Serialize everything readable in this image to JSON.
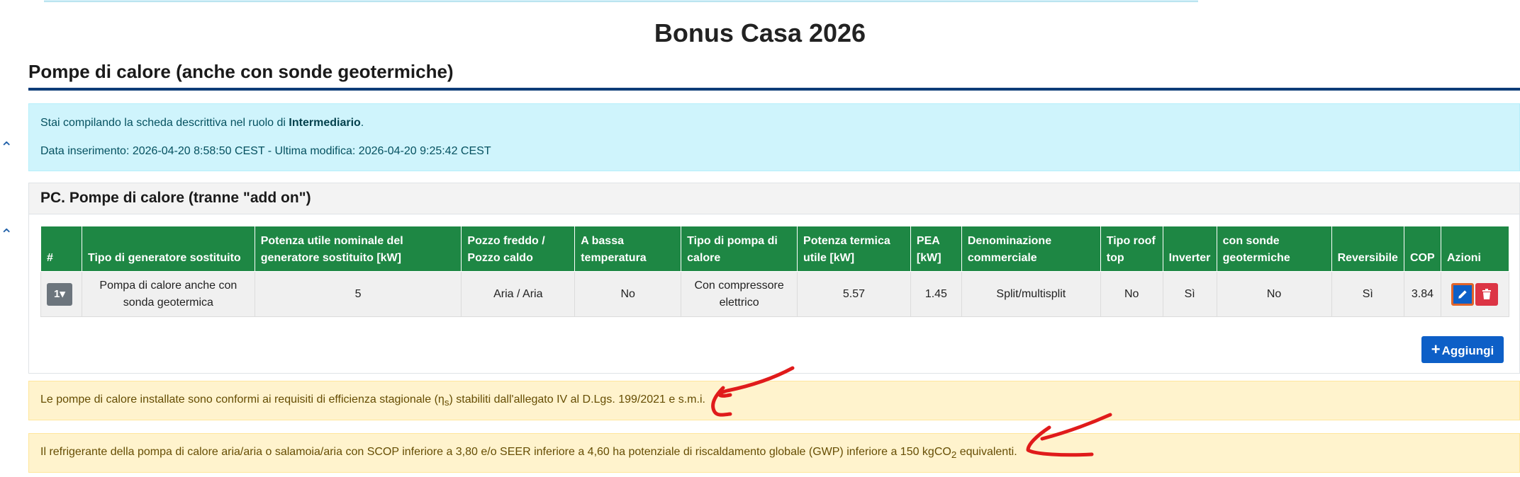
{
  "page": {
    "title": "Bonus Casa 2026"
  },
  "section": {
    "title": "Pompe di calore (anche con sonde geotermiche)"
  },
  "info": {
    "role_prefix": "Stai compilando la scheda descrittiva nel ruolo di ",
    "role": "Intermediario",
    "role_suffix": ".",
    "dates": "Data inserimento: 2026-04-20 8:58:50 CEST - Ultima modifica: 2026-04-20 9:25:42 CEST"
  },
  "card": {
    "title": "PC. Pompe di calore (tranne \"add on\")",
    "add_label": "Aggiungi",
    "table": {
      "headers": [
        "#",
        "Tipo di generatore sostituito",
        "Potenza utile nominale del generatore sostituito [kW]",
        "Pozzo freddo / Pozzo caldo",
        "A bassa temperatura",
        "Tipo di pompa di calore",
        "Potenza termica utile [kW]",
        "PEA [kW]",
        "Denominazione commerciale",
        "Tipo roof top",
        "Inverter",
        "con sonde geotermiche",
        "Reversibile",
        "COP",
        "Azioni"
      ],
      "rows": [
        {
          "index": "1▾",
          "cells": [
            "Pompa di calore anche con sonda geotermica",
            "5",
            "Aria / Aria",
            "No",
            "Con compressore elettrico",
            "5.57",
            "1.45",
            "Split/multisplit",
            "No",
            "Sì",
            "No",
            "Sì",
            "3.84"
          ]
        }
      ]
    }
  },
  "notes": {
    "efficiency_pre": "Le pompe di calore installate sono conformi ai requisiti di efficienza stagionale (",
    "efficiency_eta": "η",
    "efficiency_sub": "s",
    "efficiency_post": ") stabiliti dall'allegato IV al D.Lgs. 199/2021 e s.m.i.",
    "refrigerant_pre": "Il refrigerante della pompa di calore aria/aria o salamoia/aria con SCOP inferiore a 3,80 e/o SEER inferiore a 4,60 ha potenziale di riscaldamento globale (GWP) inferiore a 150 kgCO",
    "refrigerant_sub": "2",
    "refrigerant_post": " equivalenti."
  },
  "icons": {
    "collapse": "chevron-up-icon",
    "edit": "pencil-icon",
    "delete": "trash-icon",
    "add": "plus-icon",
    "annotation": "red-arrow-annotation"
  },
  "colors": {
    "header_green": "#1e8744",
    "primary_blue": "#0d5fc7",
    "danger_red": "#dc3545",
    "info_bg": "#cff4fc",
    "warning_bg": "#fff3cd",
    "rule_navy": "#0d3c78",
    "annotation_red": "#e01b1b"
  }
}
